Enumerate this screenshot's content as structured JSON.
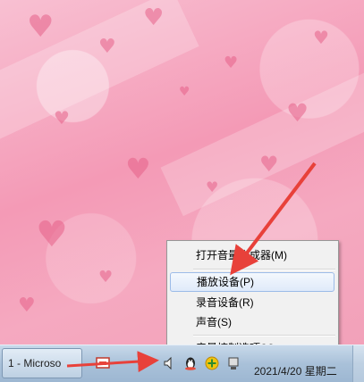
{
  "context_menu": {
    "items": [
      {
        "label": "打开音量合成器(M)"
      },
      {
        "label": "播放设备(P)"
      },
      {
        "label": "录音设备(R)"
      },
      {
        "label": "声音(S)"
      },
      {
        "label": "音量控制选项(V)"
      }
    ],
    "selected_index": 1
  },
  "taskbar": {
    "task_button_label": "1 - Microso",
    "clock": "2021/4/20 星期二",
    "tray_icons": [
      "network-icon",
      "speaker-icon",
      "qq-penguin-icon",
      "security-shield-icon",
      "device-icon"
    ]
  },
  "colors": {
    "wallpaper": "#f49ab6",
    "annotation_arrow": "#e8413a",
    "menu_highlight": "#dfeafa"
  }
}
